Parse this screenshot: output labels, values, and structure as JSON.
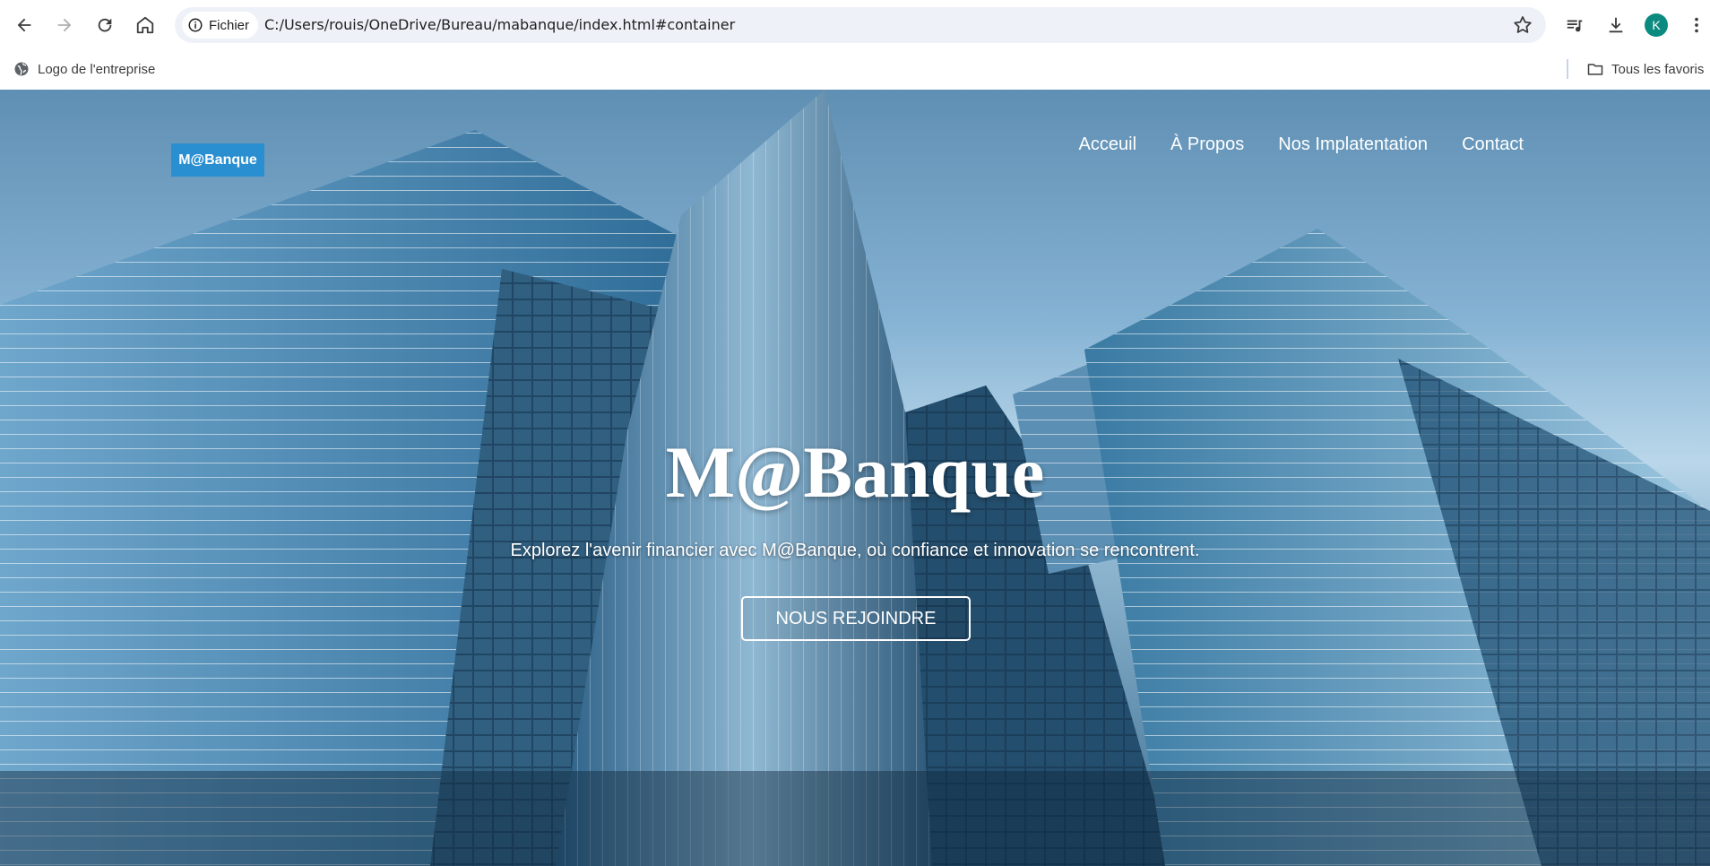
{
  "browser": {
    "security_chip": "Fichier",
    "url": "C:/Users/rouis/OneDrive/Bureau/mabanque/index.html#container",
    "profile_initial": "K",
    "bookmarks": {
      "left_item": "Logo de l'entreprise",
      "right_item": "Tous les favoris"
    }
  },
  "site": {
    "logo": "M@Banque",
    "nav": [
      "Acceuil",
      "À Propos",
      "Nos Implatentation",
      "Contact"
    ],
    "hero": {
      "title": "M@Banque",
      "subtitle": "Explorez l'avenir financier avec M@Banque, où confiance et innovation se rencontrent.",
      "cta": "NOUS REJOINDRE"
    }
  },
  "colors": {
    "logo_bg": "#2a8fd1",
    "avatar_bg": "#0b8a7f",
    "omnibox_bg": "#eef1f8"
  },
  "icons": [
    "back-icon",
    "forward-icon",
    "reload-icon",
    "home-icon",
    "info-icon",
    "star-icon",
    "media-icon",
    "download-icon",
    "menu-icon",
    "globe-icon",
    "folder-icon"
  ]
}
